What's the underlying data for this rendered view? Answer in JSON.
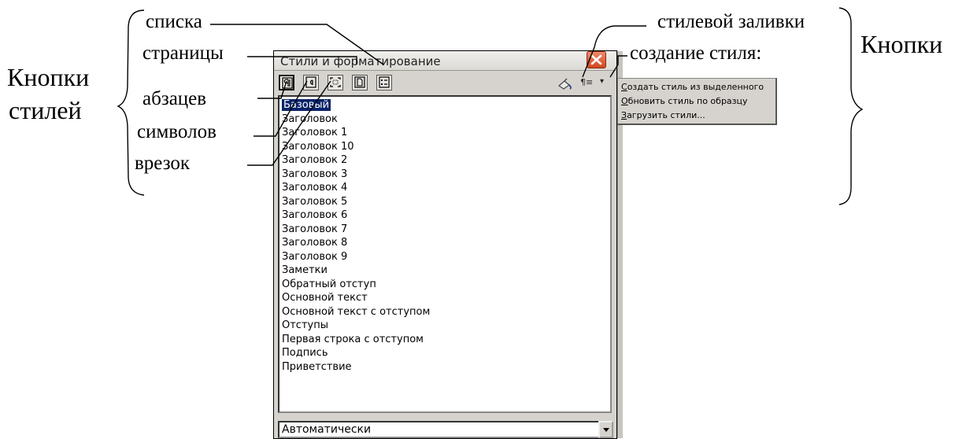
{
  "annotations": {
    "left_label_line1": "Кнопки",
    "left_label_line2": "стилей",
    "list_styles": "списка",
    "page_styles": "страницы",
    "paragraph_styles": "абзацев",
    "character_styles": "символов",
    "frame_styles": "врезок",
    "fill_format": "стилевой заливки",
    "new_style": "создание стиля:",
    "right_label": "Кнопки"
  },
  "dialog": {
    "title": "Стили и форматирование",
    "new_style_glyph": "¶≡",
    "styles": [
      "Базовый",
      "Заголовок",
      "Заголовок 1",
      "Заголовок 10",
      "Заголовок 2",
      "Заголовок 3",
      "Заголовок 4",
      "Заголовок 5",
      "Заголовок 6",
      "Заголовок 7",
      "Заголовок 8",
      "Заголовок 9",
      "Заметки",
      "Обратный отступ",
      "Основной текст",
      "Основной текст с отступом",
      "Отступы",
      "Первая строка с отступом",
      "Подпись",
      "Приветствие"
    ],
    "selected_style": "Базовый",
    "filter_value": "Автоматически"
  },
  "menu": {
    "items": [
      {
        "accel": "С",
        "rest": "оздать стиль из выделенного"
      },
      {
        "accel": "О",
        "rest": "бновить стиль по образцу"
      },
      {
        "accel": "З",
        "rest": "агрузить стили..."
      }
    ]
  },
  "colors": {
    "selection": "#0a246a",
    "close_button": "#d1461e",
    "dialog_face": "#d6d3ce"
  }
}
